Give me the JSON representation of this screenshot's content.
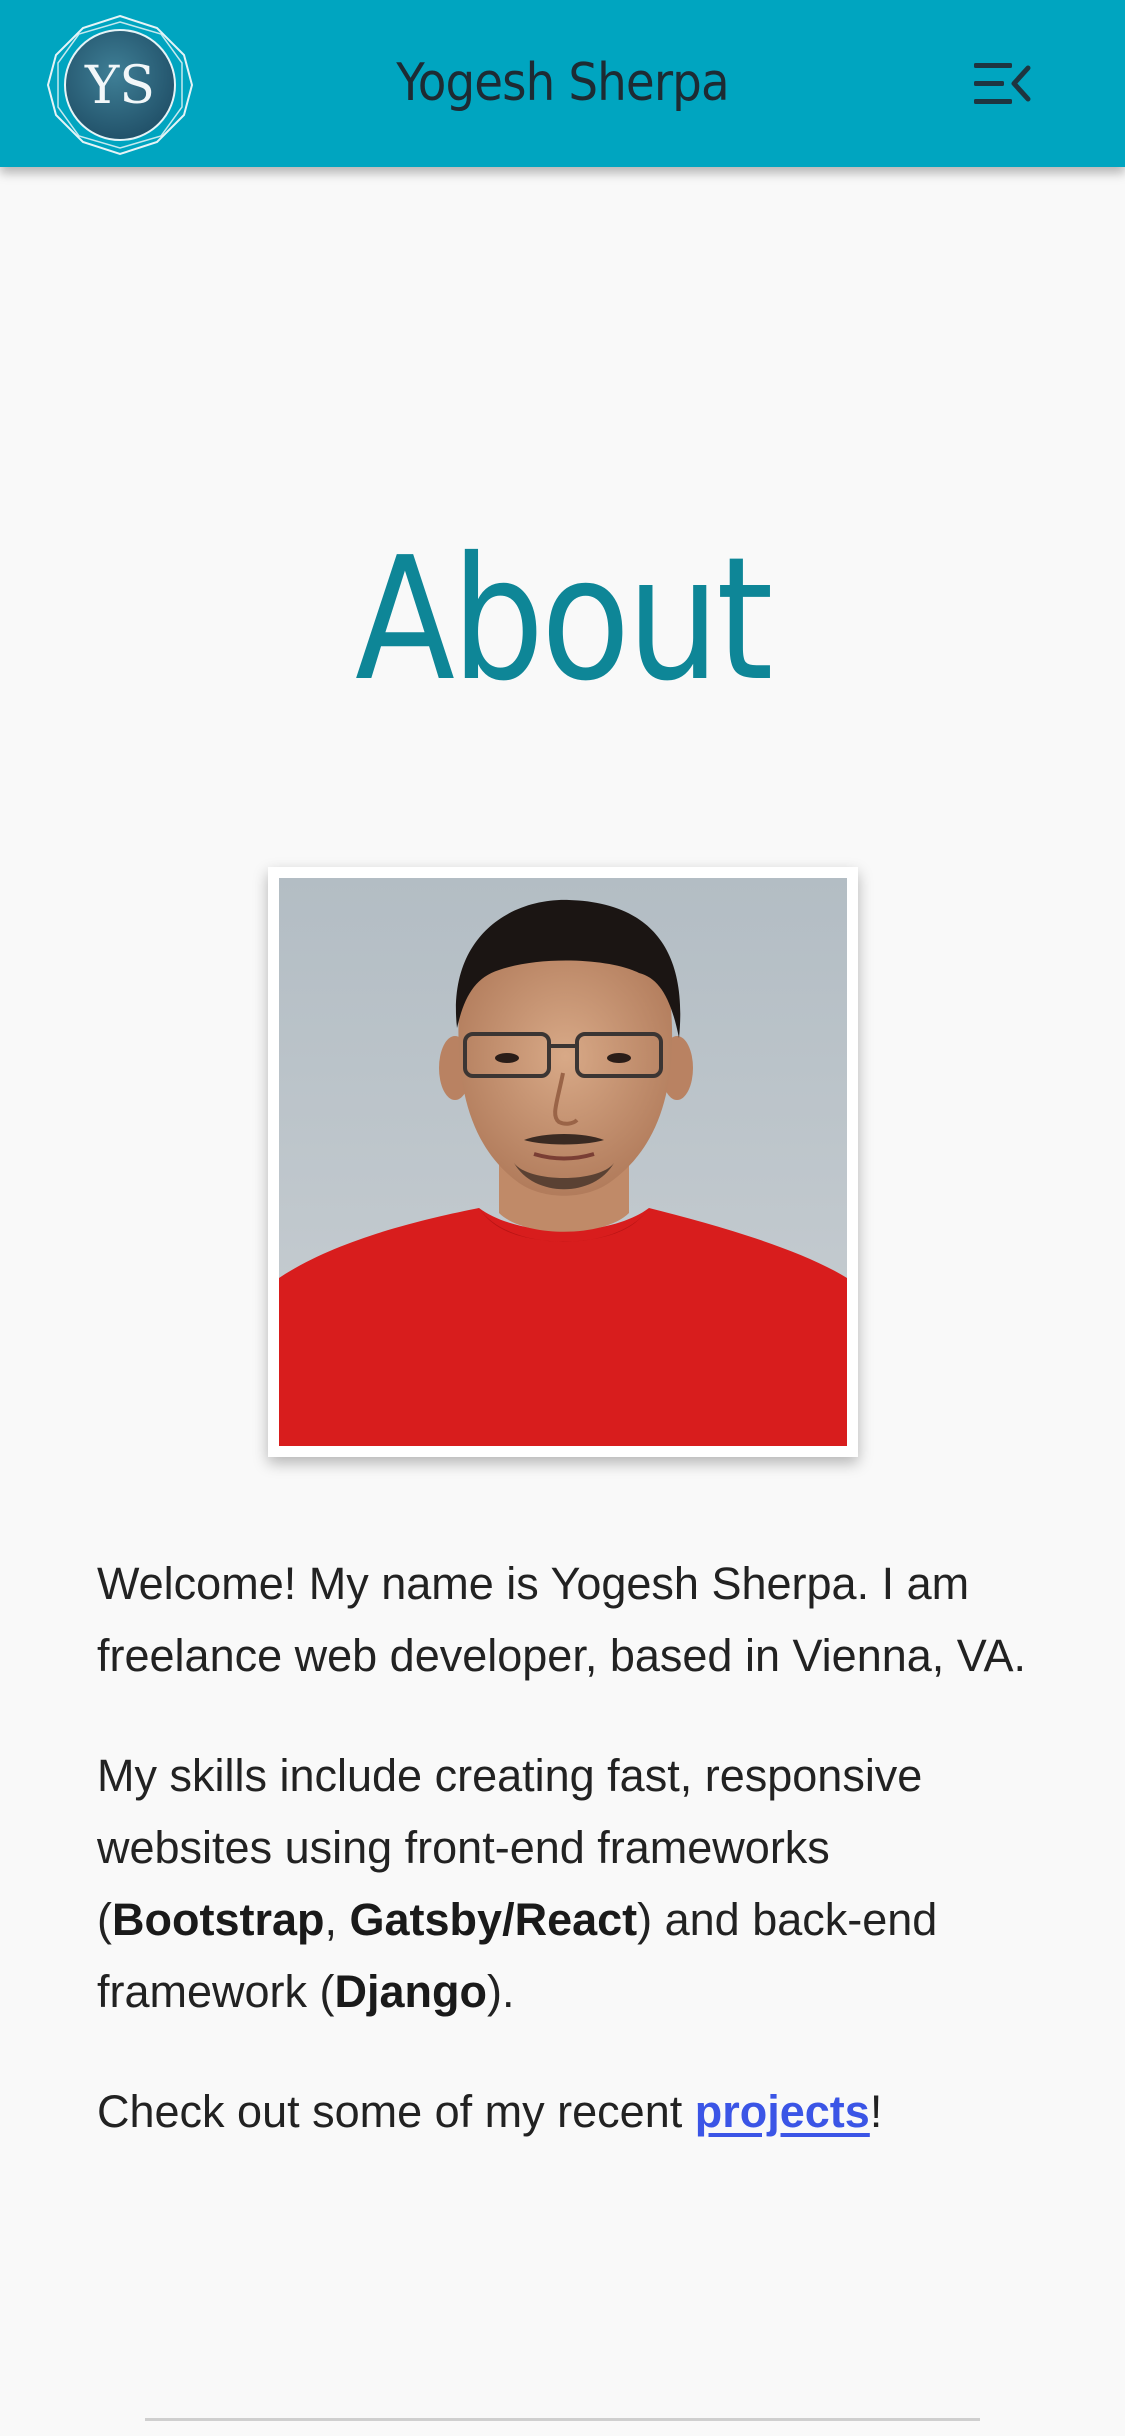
{
  "header": {
    "logo_text": "YS",
    "title": "Yogesh Sherpa",
    "menu_icon": "menu-collapse-icon",
    "bg_color": "#00a5c0"
  },
  "main": {
    "heading": "About",
    "photo_alt": "Portrait photo of Yogesh Sherpa",
    "paragraph1": "Welcome! My name is Yogesh Sherpa. I am freelance web developer, based in Vienna, VA.",
    "paragraph2": {
      "text_before": "My skills include creating fast, responsive websites using front-end frameworks (",
      "skill1": "Bootstrap",
      "sep1": ", ",
      "skill2": "Gatsby/React",
      "text_middle": ") and back-end framework (",
      "skill3": "Django",
      "text_after": ")."
    },
    "paragraph3": {
      "text_before": "Check out some of my recent ",
      "link_text": "projects",
      "text_after": "!"
    },
    "heading_color": "#0e8697",
    "link_color": "#3b55e6"
  }
}
